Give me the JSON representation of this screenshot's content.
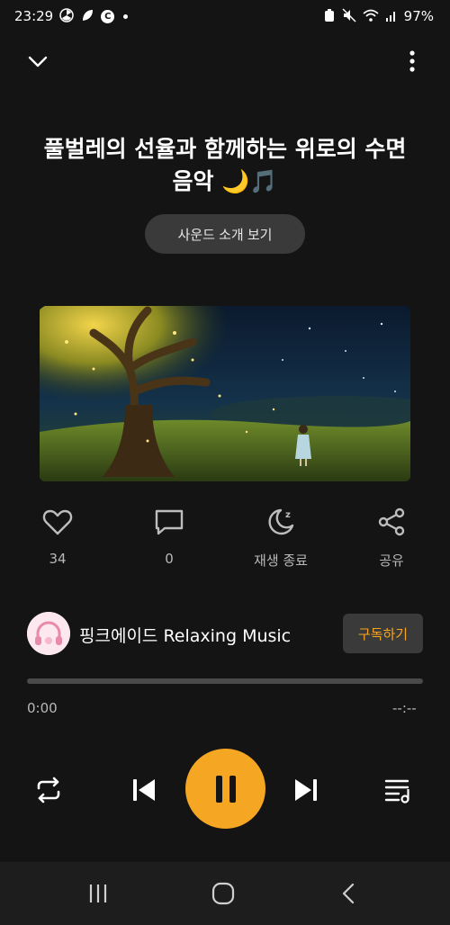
{
  "status_bar": {
    "time": "23:29",
    "battery": "97%",
    "icons": [
      "fan-icon",
      "leaf-icon",
      "c-circle-icon",
      "dot-icon",
      "recycle-icon",
      "mute-icon",
      "wifi-icon",
      "signal-icon"
    ]
  },
  "player": {
    "title": "풀벌레의 선율과 함께하는 위로의 수면음악 🌙🎵",
    "sound_intro_button": "사운드 소개 보기",
    "artwork_alt": "tree-night-scene"
  },
  "actions": {
    "like_count": "34",
    "comment_count": "0",
    "sleep_timer_label": "재생 종료",
    "share_label": "공유"
  },
  "channel": {
    "name": "핑크에이드 Relaxing Music",
    "subscribe_label": "구독하기"
  },
  "progress": {
    "current_time": "0:00",
    "total_time": "--:--",
    "fraction": 0
  },
  "colors": {
    "accent": "#f5a623",
    "background": "#141414",
    "button_bg": "#3a3a3a"
  }
}
